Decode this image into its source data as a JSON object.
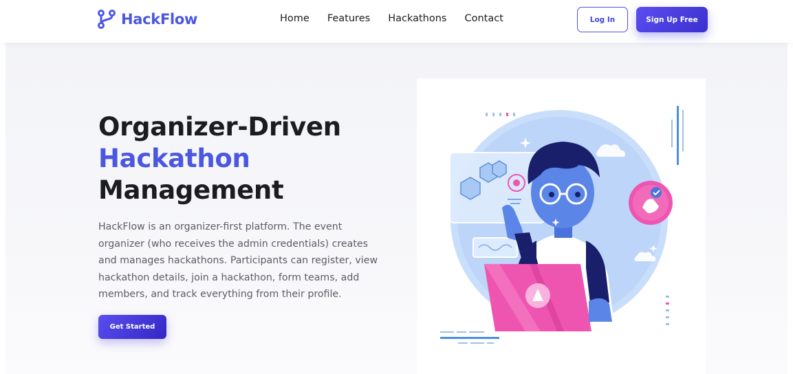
{
  "brand": {
    "name": "HackFlow",
    "icon": "git-branch-icon",
    "color": "#4b57e0"
  },
  "nav": {
    "links": [
      "Home",
      "Features",
      "Hackathons",
      "Contact"
    ],
    "login_label": "Log In",
    "signup_label": "Sign Up Free"
  },
  "hero": {
    "title_line1": "Organizer-Driven",
    "title_line2": "Hackathon",
    "title_line3": "Management",
    "description": "HackFlow is an organizer-first platform. The event organizer (who receives the admin credentials) creates and manages hackathons. Participants can register, view hackathon details, join a hackathon, form teams, add members, and track everything from their profile.",
    "cta_label": "Get Started"
  },
  "illustration": {
    "icon": "developer-at-laptop-illustration"
  },
  "colors": {
    "accent": "#4b57e0",
    "button_gradient_start": "#5b4ef0",
    "button_gradient_end": "#3a2fcf",
    "laptop_pink": "#ee55b0"
  }
}
